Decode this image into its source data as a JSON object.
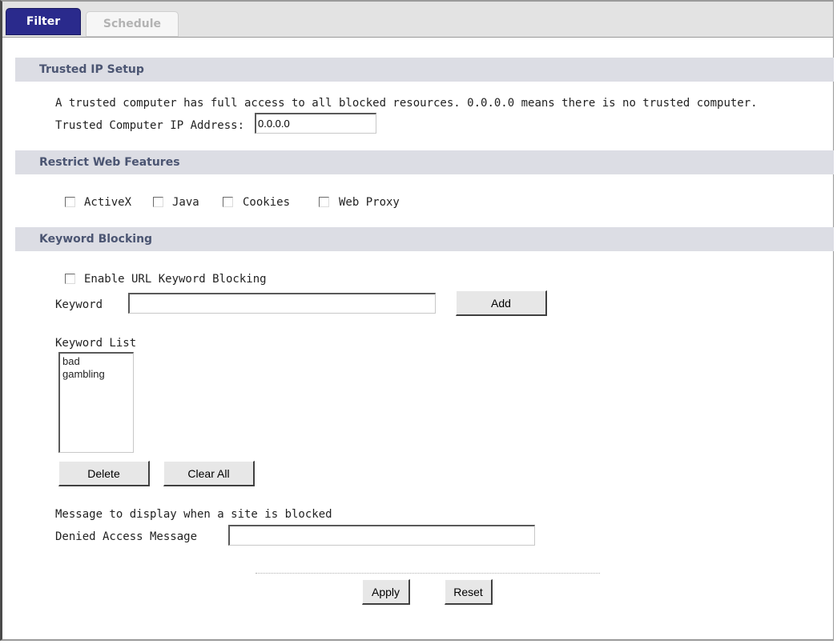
{
  "tabs": [
    {
      "label": "Filter",
      "active": true
    },
    {
      "label": "Schedule",
      "active": false
    }
  ],
  "trusted_ip": {
    "header": "Trusted IP Setup",
    "description": "A trusted computer has full access to all blocked resources. 0.0.0.0 means there is no trusted computer.",
    "ip_label": "Trusted Computer IP Address:",
    "ip_value": "0.0.0.0"
  },
  "restrict_web": {
    "header": "Restrict Web Features",
    "items": [
      {
        "label": "ActiveX",
        "checked": false
      },
      {
        "label": "Java",
        "checked": false
      },
      {
        "label": "Cookies",
        "checked": false
      },
      {
        "label": "Web Proxy",
        "checked": false
      }
    ]
  },
  "keyword_blocking": {
    "header": "Keyword Blocking",
    "enable_label": "Enable URL Keyword Blocking",
    "enable_checked": false,
    "keyword_label": "Keyword",
    "keyword_value": "",
    "add_button": "Add",
    "list_label": "Keyword List",
    "list_items": [
      "bad",
      "gambling"
    ],
    "delete_button": "Delete",
    "clear_button": "Clear All",
    "message_heading": "Message to display when a site is blocked",
    "denied_label": "Denied Access Message",
    "denied_value": ""
  },
  "actions": {
    "apply": "Apply",
    "reset": "Reset"
  },
  "colors": {
    "active_tab": "#2a2a8c",
    "section_header_bg": "#dcdde4",
    "section_header_text": "#4b5572"
  }
}
